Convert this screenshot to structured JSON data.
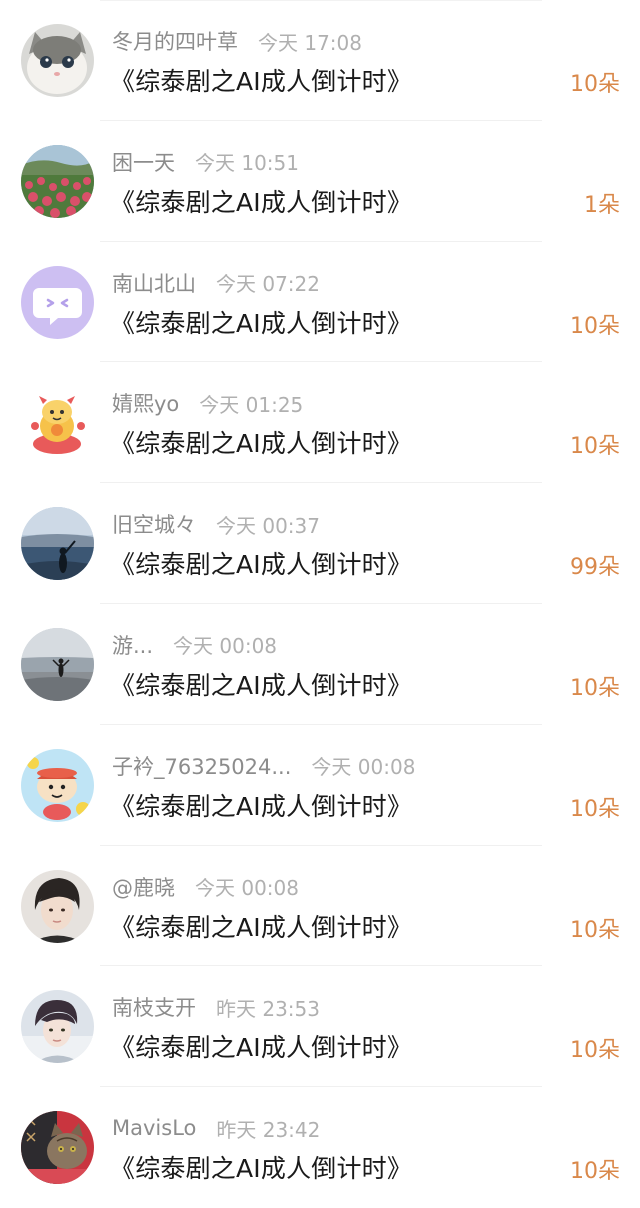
{
  "gift_list": {
    "items": [
      {
        "name": "冬月的四叶草",
        "time": "今天 17:08",
        "title": "《综泰剧之AI成人倒计时》",
        "gift": "10朵",
        "avatar_icon": "cat-avatar-icon"
      },
      {
        "name": "困一天",
        "time": "今天 10:51",
        "title": "《综泰剧之AI成人倒计时》",
        "gift": "1朵",
        "avatar_icon": "tulip-field-avatar-icon"
      },
      {
        "name": "南山北山",
        "time": "今天 07:22",
        "title": "《综泰剧之AI成人倒计时》",
        "gift": "10朵",
        "avatar_icon": "default-chat-avatar-icon"
      },
      {
        "name": "婧熙yo",
        "time": "今天 01:25",
        "title": "《综泰剧之AI成人倒计时》",
        "gift": "10朵",
        "avatar_icon": "cartoon-dragon-avatar-icon"
      },
      {
        "name": "旧空城々",
        "time": "今天 00:37",
        "title": "《综泰剧之AI成人倒计时》",
        "gift": "99朵",
        "avatar_icon": "lake-silhouette-avatar-icon"
      },
      {
        "name": "游...",
        "time": "今天 00:08",
        "title": "《综泰剧之AI成人倒计时》",
        "gift": "10朵",
        "avatar_icon": "beach-silhouette-avatar-icon"
      },
      {
        "name": "子衿_76325024...",
        "time": "今天 00:08",
        "title": "《综泰剧之AI成人倒计时》",
        "gift": "10朵",
        "avatar_icon": "cartoon-character-avatar-icon"
      },
      {
        "name": "@鹿晓",
        "time": "今天 00:08",
        "title": "《综泰剧之AI成人倒计时》",
        "gift": "10朵",
        "avatar_icon": "portrait-avatar-icon"
      },
      {
        "name": "南枝支开",
        "time": "昨天 23:53",
        "title": "《综泰剧之AI成人倒计时》",
        "gift": "10朵",
        "avatar_icon": "portrait-avatar-icon"
      },
      {
        "name": "MavisLo",
        "time": "昨天 23:42",
        "title": "《综泰剧之AI成人倒计时》",
        "gift": "10朵",
        "avatar_icon": "cat-photo-avatar-icon"
      }
    ]
  },
  "colors": {
    "name_gray": "#8c8c8c",
    "time_gray": "#b0b0b0",
    "title_black": "#1a1a1a",
    "gift_orange": "#d9884a",
    "divider": "#f0f0f0"
  }
}
